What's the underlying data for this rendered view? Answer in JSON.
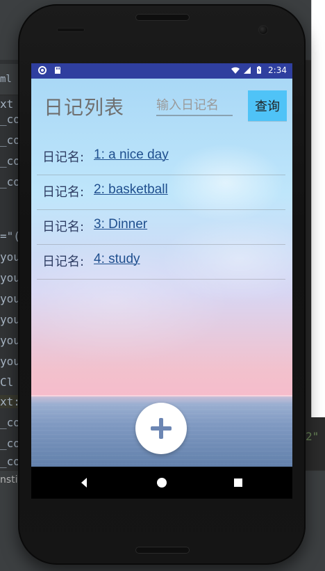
{
  "device": {
    "status_bar": {
      "time": "2:34",
      "left_icons": [
        "record-icon",
        "sd-card-icon"
      ],
      "right_icons": [
        "wifi-icon",
        "signal-icon",
        "battery-icon"
      ]
    },
    "nav_bar": {
      "buttons": [
        "back-icon",
        "home-icon",
        "recents-icon"
      ]
    }
  },
  "app": {
    "title": "日记列表",
    "search": {
      "placeholder": "输入日记名",
      "button_label": "查询"
    },
    "diary_list": {
      "prefix": "日记名:",
      "items": [
        {
          "label": "1: a nice day"
        },
        {
          "label": "2: basketball"
        },
        {
          "label": "3: Dinner"
        },
        {
          "label": "4: study"
        }
      ]
    },
    "fab": {
      "icon": "plus-icon"
    }
  },
  "ide_partial_text": {
    "tab": "ml",
    "tab_right": "xt",
    "code_lines": [
      "_co",
      "_co",
      "_co",
      "_co",
      "=\"(",
      "you",
      "you",
      "you",
      "you",
      "you",
      "you",
      "Cl",
      "xt:",
      "_co",
      "_co",
      "_co"
    ],
    "right_snippet": "2\"",
    "bottom_label": "nsti"
  },
  "colors": {
    "status_bar": "#2f3f9f",
    "search_button": "#4fc3f7",
    "link": "#1f4f8e"
  }
}
